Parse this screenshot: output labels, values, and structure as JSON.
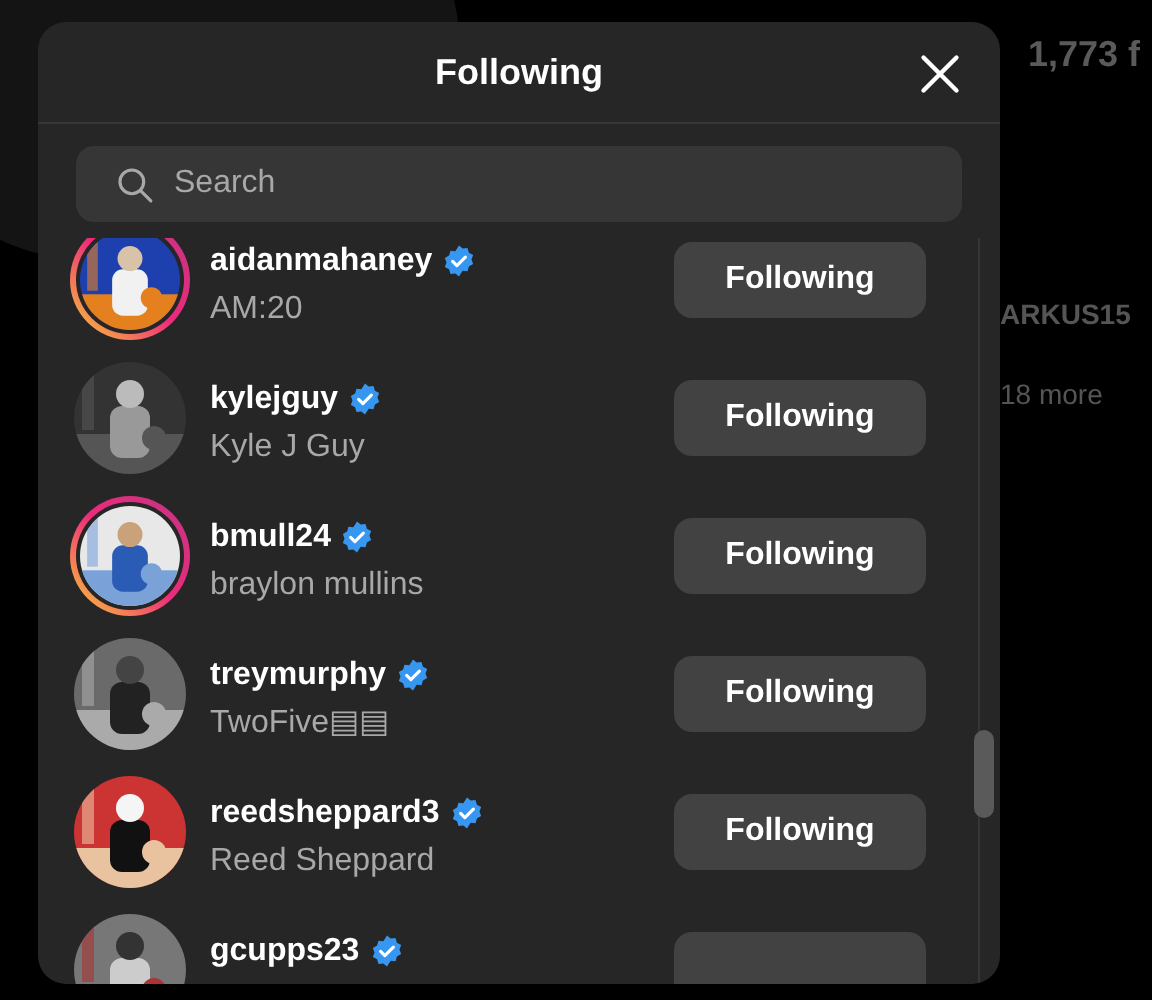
{
  "background": {
    "followers": "1,773 f",
    "username": "ARKUS15",
    "more": "18 more"
  },
  "dialog": {
    "title": "Following",
    "search": {
      "placeholder": "Search"
    },
    "accounts": [
      {
        "username": "aidanmahaney",
        "name": "AM:20",
        "verified": true,
        "story_ring": true,
        "button": "Following"
      },
      {
        "username": "kylejguy",
        "name": "Kyle J Guy",
        "verified": true,
        "story_ring": false,
        "button": "Following"
      },
      {
        "username": "bmull24",
        "name": "braylon mullins",
        "verified": true,
        "story_ring": true,
        "button": "Following"
      },
      {
        "username": "treymurphy",
        "name": "TwoFive▤▤",
        "verified": true,
        "story_ring": false,
        "button": "Following"
      },
      {
        "username": "reedsheppard3",
        "name": "Reed Sheppard",
        "verified": true,
        "story_ring": false,
        "button": "Following"
      },
      {
        "username": "gcupps23",
        "verified": true,
        "story_ring": false
      }
    ]
  }
}
